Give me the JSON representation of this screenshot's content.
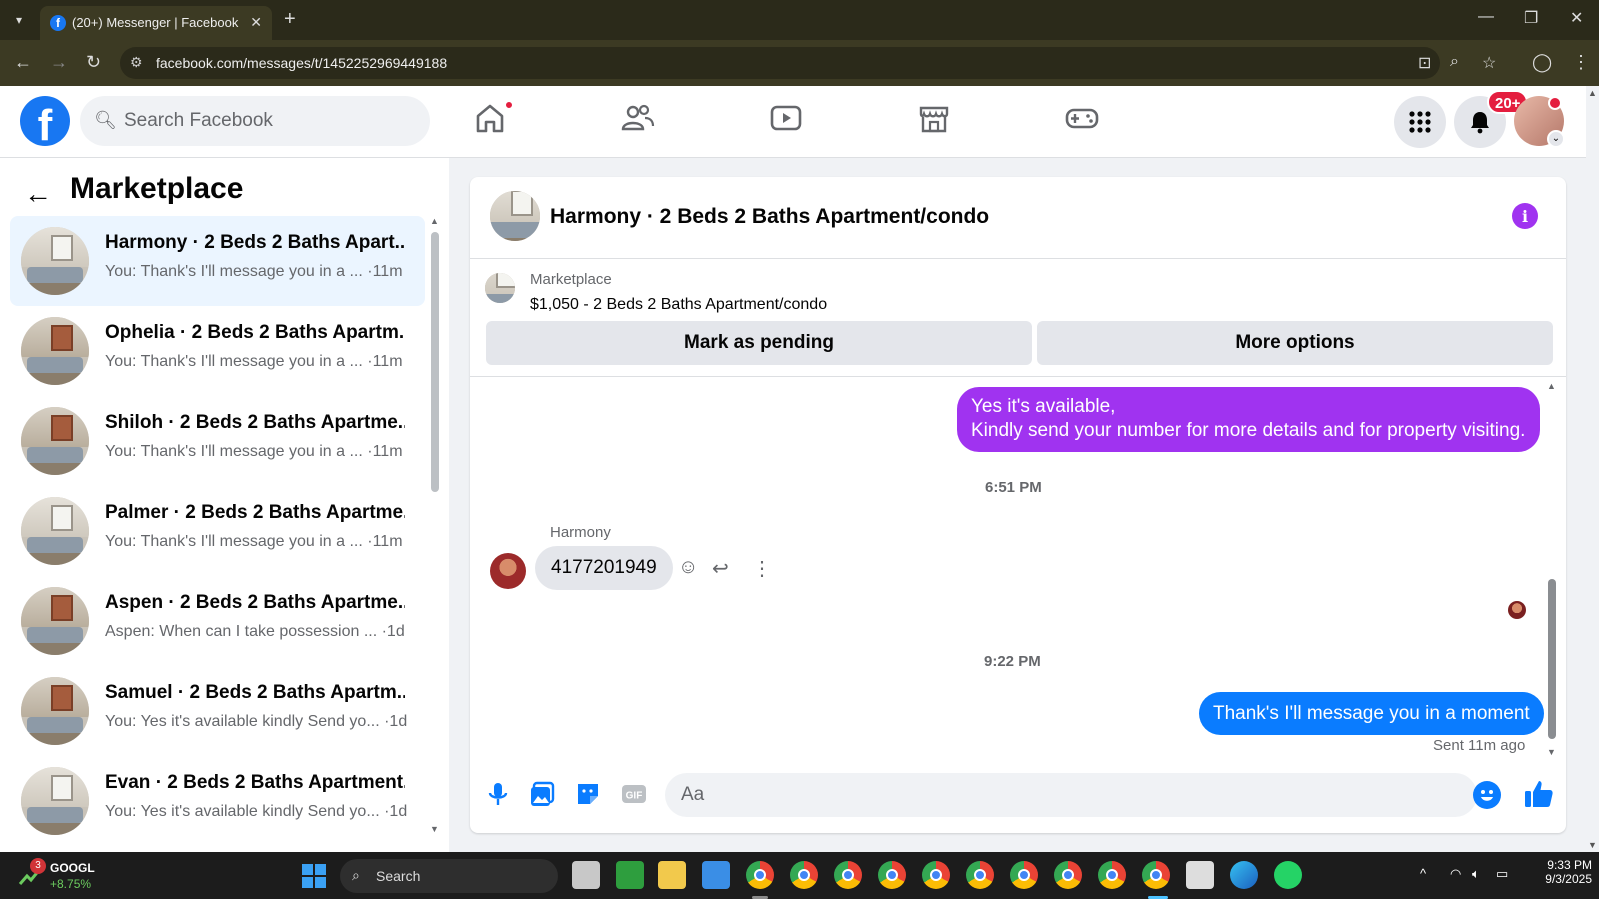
{
  "browser": {
    "tab_title": "(20+) Messenger | Facebook",
    "url": "facebook.com/messages/t/1452252969449188"
  },
  "facebook": {
    "search_placeholder": "Search Facebook",
    "notifications_badge": "20+"
  },
  "left_panel": {
    "title": "Marketplace",
    "conversations": [
      {
        "name": "Harmony · 2 Beds 2 Baths Apart...",
        "snippet": "You: Thank's I'll message you in a ... ·11m",
        "active": true
      },
      {
        "name": "Ophelia · 2 Beds 2 Baths Apartm...",
        "snippet": "You: Thank's I'll message you in a ... ·11m",
        "active": false
      },
      {
        "name": "Shiloh · 2 Beds 2 Baths Apartme...",
        "snippet": "You: Thank's I'll message you in a ... ·11m",
        "active": false
      },
      {
        "name": "Palmer · 2 Beds 2 Baths Apartme...",
        "snippet": "You: Thank's I'll message you in a ... ·11m",
        "active": false
      },
      {
        "name": "Aspen · 2 Beds 2 Baths Apartme...",
        "snippet": "Aspen: When can I take possession ... ·1d",
        "active": false
      },
      {
        "name": "Samuel · 2 Beds 2 Baths Apartm...",
        "snippet": "You: Yes it's available kindly Send yo... ·1d",
        "active": false
      },
      {
        "name": "Evan · 2 Beds 2 Baths Apartment...",
        "snippet": "You: Yes it's available kindly Send yo... ·1d",
        "active": false
      }
    ]
  },
  "chat": {
    "title": "Harmony · 2 Beds 2 Baths Apartment/condo",
    "listing_source": "Marketplace",
    "listing_item": "$1,050 - 2 Beds 2 Baths Apartment/condo",
    "mark_pending_label": "Mark as pending",
    "more_options_label": "More options",
    "messages": {
      "out_1_line1": "Yes it's available,",
      "out_1_line2": "Kindly send your number for more details and for property visiting.",
      "time_1": "6:51 PM",
      "sender_name": "Harmony",
      "in_1": "4177201949",
      "time_2": "9:22 PM",
      "out_2": "Thank's I'll message you in a moment",
      "sent_status": "Sent 11m ago"
    },
    "composer_placeholder": "Aa"
  },
  "taskbar": {
    "stock_name": "GOOGL",
    "stock_change": "+8.75%",
    "stock_badge": "3",
    "search_label": "Search",
    "time": "9:33 PM",
    "date": "9/3/2025"
  },
  "colors": {
    "fb_blue": "#1877f2",
    "purple_bubble": "#a033f0",
    "blue_bubble": "#0a7cff",
    "active_conv_bg": "#ebf5ff"
  }
}
